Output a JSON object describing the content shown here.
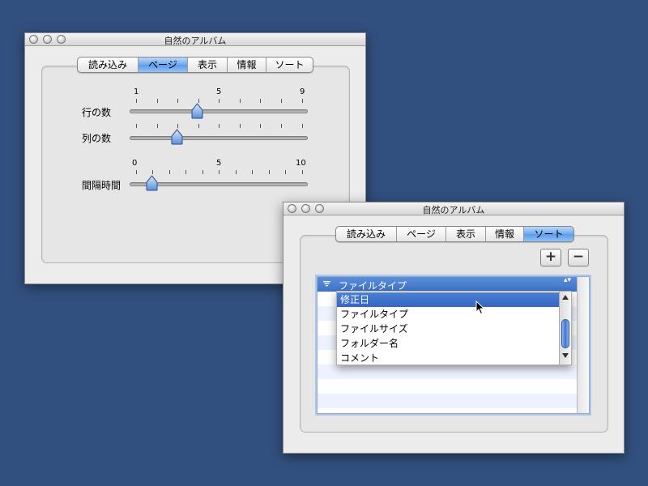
{
  "window1": {
    "title": "自然のアルバム",
    "tabs": [
      "読み込み",
      "ページ",
      "表示",
      "情報",
      "ソート"
    ],
    "selected_tab": "ページ",
    "rows_slider": {
      "label": "行の数",
      "min_label": "1",
      "mid_label": "5",
      "max_label": "9",
      "value": 4
    },
    "cols_slider": {
      "label": "列の数",
      "value": 3
    },
    "interval_slider": {
      "label": "間隔時間",
      "min_label": "0",
      "mid_label": "5",
      "max_label": "10",
      "value": 1
    }
  },
  "window2": {
    "title": "自然のアルバム",
    "tabs": [
      "読み込み",
      "ページ",
      "表示",
      "情報",
      "ソート"
    ],
    "selected_tab": "ソート",
    "add_label": "+",
    "remove_label": "−",
    "sort_header": {
      "icon": "sort-direction-icon",
      "value": "ファイルタイプ",
      "arrows": "▴▾"
    },
    "popup_options": [
      "修正日",
      "ファイルタイプ",
      "ファイルサイズ",
      "フォルダー名",
      "コメント"
    ],
    "highlighted_option": "修正日"
  },
  "colors": {
    "desktop": "#32507f",
    "selection_blue": "#3e72c8",
    "tab_selected": "#6fa9ee",
    "row_stripe": "#edf3fe"
  }
}
